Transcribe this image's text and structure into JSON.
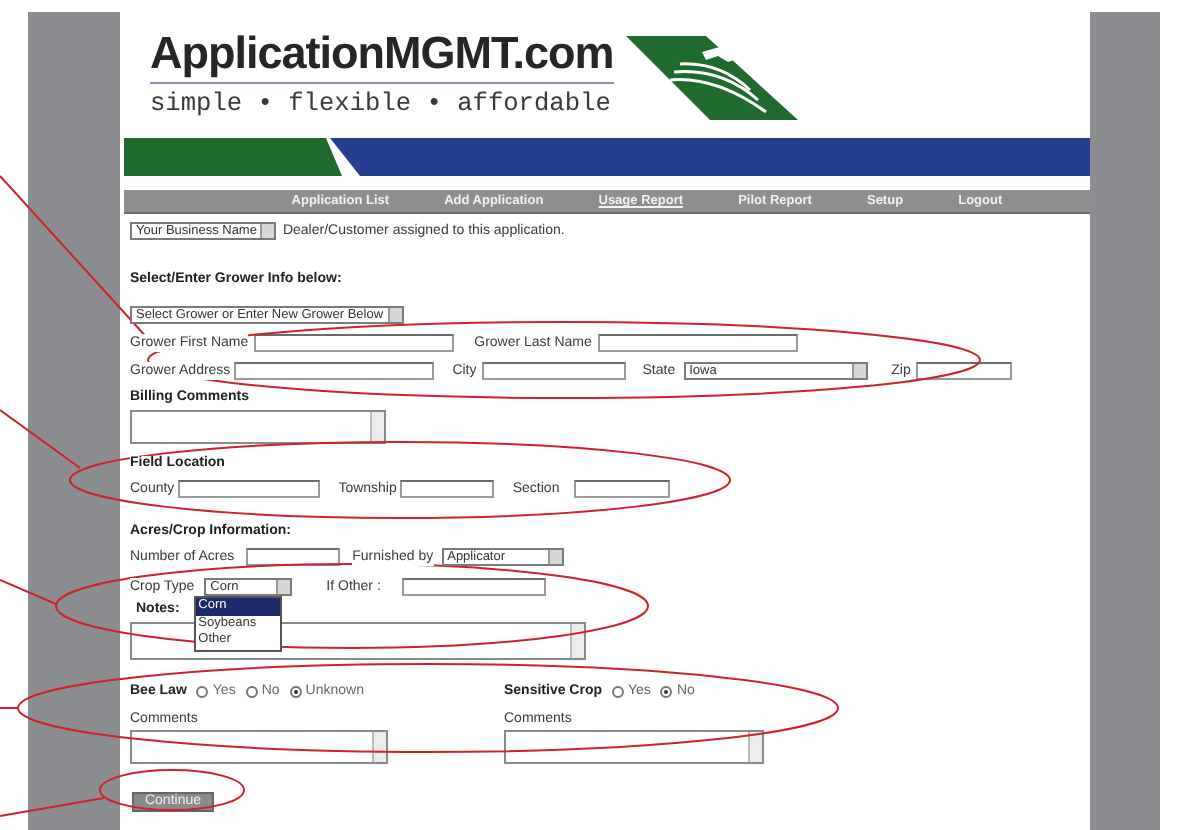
{
  "header": {
    "title": "ApplicationMGMT.com",
    "tagline": "simple • flexible • affordable"
  },
  "nav": [
    {
      "label": "Application List",
      "selected": false
    },
    {
      "label": "Add Application",
      "selected": false
    },
    {
      "label": "Usage Report",
      "selected": true
    },
    {
      "label": "Pilot Report",
      "selected": false
    },
    {
      "label": "Setup",
      "selected": false
    },
    {
      "label": "Logout",
      "selected": false
    }
  ],
  "dealer": {
    "select": "Your Business Name",
    "note": "Dealer/Customer assigned to this application."
  },
  "grower": {
    "heading": "Select/Enter Grower Info below:",
    "select": "Select Grower or Enter New Grower Below",
    "first_name_label": "Grower First Name",
    "last_name_label": "Grower Last Name",
    "address_label": "Grower Address",
    "city_label": "City",
    "state_label": "State",
    "state_value": "Iowa",
    "zip_label": "Zip"
  },
  "billing": {
    "heading": "Billing Comments"
  },
  "field_location": {
    "heading": "Field Location",
    "county_label": "County",
    "township_label": "Township",
    "section_label": "Section"
  },
  "acres_crop": {
    "heading": "Acres/Crop Information:",
    "acres_label": "Number of Acres",
    "furnished_label": "Furnished by",
    "furnished_value": "Applicator",
    "crop_type_label": "Crop Type",
    "crop_type_value": "Corn",
    "crop_options": [
      {
        "label": "Corn",
        "selected": true
      },
      {
        "label": "Soybeans",
        "selected": false
      },
      {
        "label": "Other",
        "selected": false
      }
    ],
    "other_label": "If Other :",
    "notes_label": "Notes:"
  },
  "bee_law": {
    "label": "Bee Law",
    "options": [
      {
        "label": "Yes",
        "selected": false
      },
      {
        "label": "No",
        "selected": false
      },
      {
        "label": "Unknown",
        "selected": true
      }
    ],
    "comments_label": "Comments"
  },
  "sensitive_crop": {
    "label": "Sensitive Crop",
    "options": [
      {
        "label": "Yes",
        "selected": false
      },
      {
        "label": "No",
        "selected": true
      }
    ],
    "comments_label": "Comments"
  },
  "continue_button": "Continue"
}
